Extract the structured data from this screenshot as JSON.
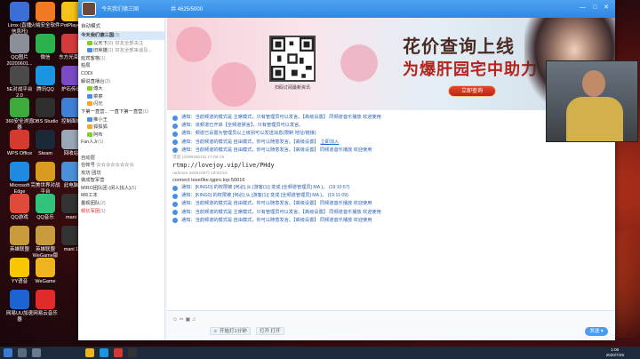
{
  "desktop": {
    "icons": [
      {
        "label": "Lirox (直播\n信息托)",
        "color": "#3b6fd6",
        "col": 0,
        "row": 0
      },
      {
        "label": "火绒安全软件",
        "color": "#f07a23",
        "col": 1,
        "row": 0
      },
      {
        "label": "PotPlayer",
        "color": "#f5c21a",
        "col": 2,
        "row": 0
      },
      {
        "label": "QQ图片\n20200601...",
        "color": "#8a8f9a",
        "col": 0,
        "row": 1
      },
      {
        "label": "微信",
        "color": "#2bb24c",
        "col": 1,
        "row": 1
      },
      {
        "label": "东方光束下",
        "color": "#d43b3b",
        "col": 2,
        "row": 1
      },
      {
        "label": "5E对战平台\n2.0",
        "color": "#4a4a4a",
        "col": 0,
        "row": 2
      },
      {
        "label": "腾讯QQ",
        "color": "#1b95e0",
        "col": 1,
        "row": 2
      },
      {
        "label": "炉石传说",
        "color": "#7b4bc7",
        "col": 2,
        "row": 2
      },
      {
        "label": "360安全浏览\n器",
        "color": "#3cab3c",
        "col": 0,
        "row": 3
      },
      {
        "label": "OBS Studio",
        "color": "#2f2f2f",
        "col": 1,
        "row": 3
      },
      {
        "label": "控制面板",
        "color": "#3f7fd4",
        "col": 2,
        "row": 3
      },
      {
        "label": "WPS Office",
        "color": "#d53a2e",
        "col": 0,
        "row": 4
      },
      {
        "label": "Steam",
        "color": "#1b2838",
        "col": 1,
        "row": 4
      },
      {
        "label": "回收站",
        "color": "#9aa7b6",
        "col": 2,
        "row": 4
      },
      {
        "label": "Microsoft\nEdge",
        "color": "#1f8ae0",
        "col": 0,
        "row": 5
      },
      {
        "label": "完美世界对战\n平台",
        "color": "#d89a1f",
        "col": 1,
        "row": 5
      },
      {
        "label": "此电脑",
        "color": "#4a90d9",
        "col": 2,
        "row": 5
      },
      {
        "label": "QQ游戏",
        "color": "#e04a38",
        "col": 0,
        "row": 6
      },
      {
        "label": "QQ音乐",
        "color": "#31c27c",
        "col": 1,
        "row": 6
      },
      {
        "label": "mani",
        "color": "#333333",
        "col": 2,
        "row": 6
      },
      {
        "label": "英雄联盟",
        "color": "#c89b3c",
        "col": 0,
        "row": 7
      },
      {
        "label": "英雄联盟\nWeGame版",
        "color": "#c89b3c",
        "col": 1,
        "row": 7
      },
      {
        "label": "mani 1",
        "color": "#333333",
        "col": 2,
        "row": 7
      },
      {
        "label": "YY语音",
        "color": "#f7c600",
        "col": 0,
        "row": 8
      },
      {
        "label": "WeGame",
        "color": "#f0b320",
        "col": 1,
        "row": 8
      },
      {
        "label": "网易UU加速\n器",
        "color": "#1e63d2",
        "col": 0,
        "row": 9
      },
      {
        "label": "网易云音乐",
        "color": "#e12b2b",
        "col": 1,
        "row": 9
      }
    ]
  },
  "qq": {
    "title": "今天我们德三国",
    "title_meta": "共 4625/5000",
    "window_controls": "— □ ✕",
    "left_header": "自动模式",
    "mid_header": "所有人员",
    "tree": [
      {
        "text": "今天我们德三国",
        "count": "(3)",
        "child": false,
        "bold": true
      },
      {
        "text": "以天下",
        "count": "(2)",
        "child": true,
        "extra": "好友全部关注"
      },
      {
        "text": "旧英雄",
        "count": "(1)",
        "child": true,
        "extra": "好友全部来谈及..."
      },
      {
        "text": "延宾客格",
        "count": "(1)",
        "child": false
      },
      {
        "text": "柏局",
        "count": "",
        "child": false
      },
      {
        "text": "CODI",
        "count": "",
        "child": false
      },
      {
        "text": "解说直播台",
        "count": "(3)",
        "child": false
      },
      {
        "text": "傅大",
        "count": "",
        "child": true
      },
      {
        "text": "菜菜",
        "count": "",
        "child": true
      },
      {
        "text": "闪光",
        "count": "",
        "child": true
      },
      {
        "text": "下第一直营... 一直下第一直营",
        "count": "(1)",
        "child": false
      },
      {
        "text": "推小王",
        "count": "",
        "child": true
      },
      {
        "text": "狐狐狐",
        "count": "",
        "child": true
      },
      {
        "text": "阿布",
        "count": "",
        "child": true
      },
      {
        "text": "Fan人Jr",
        "count": "(1)",
        "child": false
      },
      {
        "text": "",
        "count": "",
        "child": false
      },
      {
        "text": "自动层",
        "count": "",
        "child": false
      },
      {
        "text": "在帐号 ☆☆☆☆☆☆☆☆",
        "count": "",
        "child": false
      },
      {
        "text": "攻坊 团坊",
        "count": "",
        "child": false
      },
      {
        "text": "做成智军营",
        "count": "",
        "child": false
      },
      {
        "text": "MIRO团队团 (闲人找人)",
        "count": "(5)",
        "child": false
      },
      {
        "text": "MR工本",
        "count": "",
        "child": false
      },
      {
        "text": "量视团队",
        "count": "(2)",
        "child": false
      },
      {
        "text": "频长军团",
        "count": "(1)",
        "child": false,
        "red": true
      }
    ],
    "banner": {
      "title_line1": "花价查询上线",
      "title_line2": "为爆肝园宅中助力！",
      "qr_caption": "扫码订阅最新资讯",
      "button_label": "立即查询"
    },
    "messages": [
      {
        "type": "notice",
        "text": "通知：当前频道的模式是 主席模式，只有管理员可以发言。【高级设置】 同频道音乐播放 欢迎使用"
      },
      {
        "type": "notice",
        "text": "通知：该频道已开启【全频道禁言】，只有管理员可以发言。"
      },
      {
        "type": "notice",
        "text": "通知：频道已设置为管理员以上级别可以发送消息(限制 地址/链接)"
      },
      {
        "type": "notice_link",
        "text": "通知：当前频道的模式是 自由模式，你可以随意发言。【高级设置】",
        "link": "立即加入"
      },
      {
        "type": "notice",
        "text": "通知：当前频道的模式是 自由模式，你可以随意发言。【高级设置】 同频道音乐播放 欢迎使用"
      },
      {
        "type": "sender",
        "text": "漂亮 (259926015) 17:09:19"
      },
      {
        "type": "big",
        "text": "rtmp://lovejoy.vip/live/PHdy"
      },
      {
        "type": "sender",
        "text": "radimen 26482397) 19:03:53"
      },
      {
        "type": "dark",
        "text": "connect tese0ke.tgpro.top:50016"
      },
      {
        "type": "notice",
        "text": "通知：[KINGO] 的权限被 [何必] 从 [游客(1)] 变成 [全频道管理员] MA )。 (19:10:57)"
      },
      {
        "type": "notice",
        "text": "通知：[KING0] 的权限被 [何必] 从 [游客(1)] 变成 [全频道管理员] MA )。 (19:11:09)"
      },
      {
        "type": "notice",
        "text": "通知：当前频道的模式是 自由模式，你可以随意发言。【高级设置】 同频道音乐播放 欢迎使用"
      },
      {
        "type": "notice",
        "text": "通知：当前频道的模式是 主席模式，只有管理员可以发言。【高级设置】 同频道音乐播放 欢迎使用"
      },
      {
        "type": "notice",
        "text": "通知：当前频道的模式是 自由模式，你可以随意发言。【高级设置】 同频道音乐播放 欢迎使用"
      }
    ],
    "input": {
      "tools": "☺  ✂  ▣  ♫",
      "send_label": "发送 ▾",
      "status_btn1": "♬ 开始打1分钟",
      "status_btn2": "打开 打开"
    }
  },
  "taskbar": {
    "time": "1:06",
    "date": "2020/7/25"
  }
}
